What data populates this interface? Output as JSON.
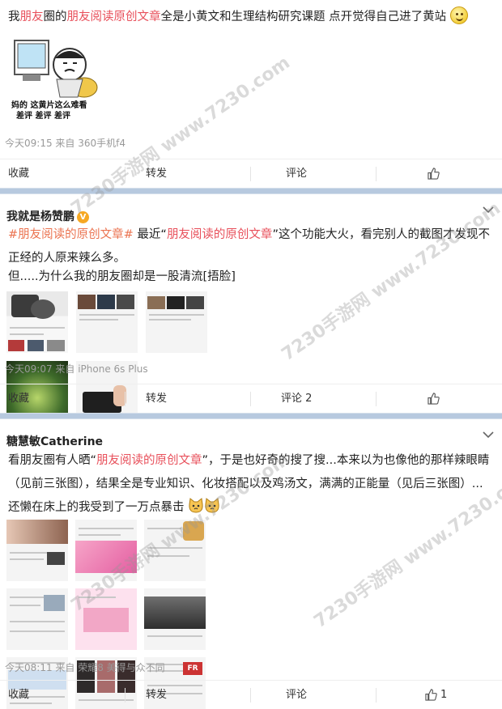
{
  "posts": [
    {
      "text_parts": [
        "我",
        "朋友",
        "圈的",
        "朋友阅读原创文章",
        "全是小黄文和生理结构研究课题 点开觉得自己进了黄站"
      ],
      "image_caption": [
        "妈的 这黄片这么难看",
        "差评 差评 差评"
      ],
      "meta": "今天09:15 来自 360手机f4",
      "actions": {
        "collect": "收藏",
        "forward": "转发",
        "comment": "评论",
        "like": ""
      }
    },
    {
      "author": "我就是杨赞鹏",
      "verified_badge": "V",
      "hashtag": "#朋友阅读的原创文章#",
      "text_a": " 最近“",
      "text_link": "朋友阅读的原创文章",
      "text_b": "”这个功能大火，看完别人的截图才发现不正经的人原来辣么多。",
      "text_line2": "但.....为什么我的朋友圈却是一股清流[捂脸]",
      "meta": "今天09:07 来自 iPhone 6s Plus",
      "actions": {
        "collect": "收藏",
        "forward": "转发",
        "comment": "评论 2",
        "like": ""
      }
    },
    {
      "author": "糖慧敏Catherine",
      "text_a": "看朋友圈有人晒“",
      "text_link": "朋友阅读的原创文章",
      "text_b": "”，于是也好奇的搜了搜...本来以为也像他的那样辣眼睛（见前三张图），结果全是专业知识、化妆搭配以及鸡汤文，满满的正能量（见后三张图）...还懒在床上的我受到了一万点暴击",
      "meta": "今天08:11 来自 荣耀8 美得与众不同",
      "actions": {
        "collect": "收藏",
        "forward": "转发",
        "comment": "评论",
        "like": "1"
      }
    }
  ],
  "colors": {
    "highlight": "#e8505b",
    "link": "#eb7350",
    "separator": "#b7c9df",
    "meta": "#999999"
  },
  "icons": [
    "thumbs-up-icon",
    "chevron-down-icon",
    "smiley-icon",
    "cat-emoji-icon",
    "verified-badge-icon"
  ],
  "watermark": "7230手游网 www.7230.com"
}
